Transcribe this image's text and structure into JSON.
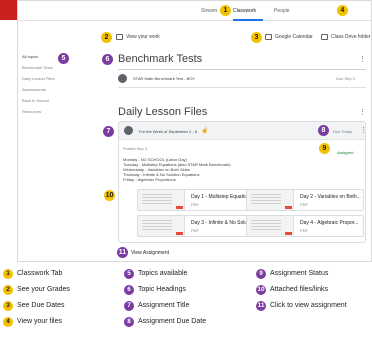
{
  "nav": {
    "tabs": [
      "Stream",
      "Classwork",
      "People"
    ],
    "active": "Classwork"
  },
  "toolbar": {
    "view_work": "View your work",
    "google_calendar": "Google Calendar",
    "class_drive": "Class Drive folder"
  },
  "sidebar": {
    "items": [
      "All topics",
      "Benchmark Tests",
      "Daily Lesson Files",
      "Assessments",
      "Back to School",
      "Resources"
    ]
  },
  "benchmark": {
    "title": "Benchmark Tests",
    "item_title": "STAR Math Benchmark Test - BOY",
    "item_due": "Due Sep 3"
  },
  "daily": {
    "title": "Daily Lesson Files",
    "assignment_title": "For the Week of September 2 - 6",
    "due": "Due Today",
    "posted": "Posted Sep 3",
    "status": "Assigned",
    "schedule": [
      "Monday - NO SCHOOL (Labor Day)",
      "Tuesday - Multistep Equations (also STAR Math Benchmark)",
      "Wednesday - Variables on Both Sides",
      "Thursday - Infinite & No Solution Equations",
      "Friday - Algebraic Proportions"
    ],
    "files": [
      {
        "title": "Day 1 - Multistep Equatio...",
        "type": "PDF"
      },
      {
        "title": "Day 2 - Variables on Both...",
        "type": "PDF"
      },
      {
        "title": "Day 3 - Infinite & No Solu...",
        "type": "PDF"
      },
      {
        "title": "Day 4 - Algebraic Propor...",
        "type": "PDF"
      }
    ],
    "view_assignment": "View Assignment"
  },
  "markers": [
    "1",
    "2",
    "3",
    "4",
    "5",
    "6",
    "7",
    "8",
    "9",
    "10",
    "11"
  ],
  "legend": [
    {
      "n": "1",
      "label": "Classwork Tab",
      "color": "#f2c200"
    },
    {
      "n": "2",
      "label": "See your Grades",
      "color": "#f2c200"
    },
    {
      "n": "3",
      "label": "See Due Dates",
      "color": "#f2c200"
    },
    {
      "n": "4",
      "label": "View your files",
      "color": "#f2c200"
    },
    {
      "n": "5",
      "label": "Topics available",
      "color": "#7b3ca1"
    },
    {
      "n": "6",
      "label": "Topic Headings",
      "color": "#7b3ca1"
    },
    {
      "n": "7",
      "label": "Assignment Title",
      "color": "#7b3ca1"
    },
    {
      "n": "8",
      "label": "Assignment Due Date",
      "color": "#7b3ca1"
    },
    {
      "n": "9",
      "label": "Assignment Status",
      "color": "#7b3ca1"
    },
    {
      "n": "10",
      "label": "Attached files/links",
      "color": "#7b3ca1"
    },
    {
      "n": "11",
      "label": "Click to view assignment",
      "color": "#7b3ca1"
    }
  ]
}
